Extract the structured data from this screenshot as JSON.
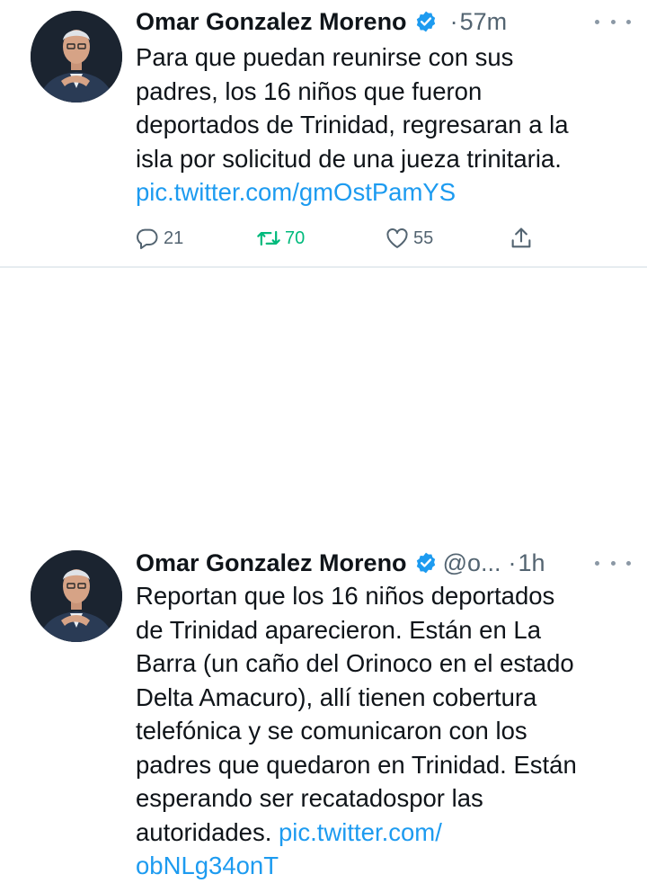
{
  "accent_color": "#1d9bf0",
  "retweet_color": "#00ba7c",
  "tweets": [
    {
      "author_name": "Omar Gonzalez Moreno",
      "separator": "·",
      "time": "57m",
      "text_lines": [
        "Para que puedan reunirse con sus",
        "padres, los 16 niños que fueron",
        "deportados de Trinidad, regresaran a la",
        "isla por solicitud de una jueza trinitaria."
      ],
      "link": "pic.twitter.com/gmOstPamYS",
      "reply_count": "21",
      "retweet_count": "70",
      "like_count": "55",
      "icons": [
        "verified-badge-icon",
        "more-icon",
        "reply-icon",
        "retweet-icon",
        "like-icon",
        "share-icon"
      ]
    },
    {
      "author_name": "Omar Gonzalez Moreno",
      "handle": "@o...",
      "separator": "·",
      "time": "1h",
      "text_lines": [
        "Reportan que los 16 niños deportados",
        "de Trinidad aparecieron.  Están en La",
        "Barra (un caño del Orinoco en el estado",
        "Delta Amacuro), allí tienen cobertura",
        "telefónica y se comunicaron con los",
        "padres que quedaron en Trinidad. Están",
        "esperando ser recatadospor las"
      ],
      "last_line_text": "autoridades. ",
      "link_part_1": "pic.twitter.com/",
      "link_part_2": "obNLg34onT",
      "icons": [
        "verified-badge-icon",
        "more-icon"
      ]
    }
  ]
}
